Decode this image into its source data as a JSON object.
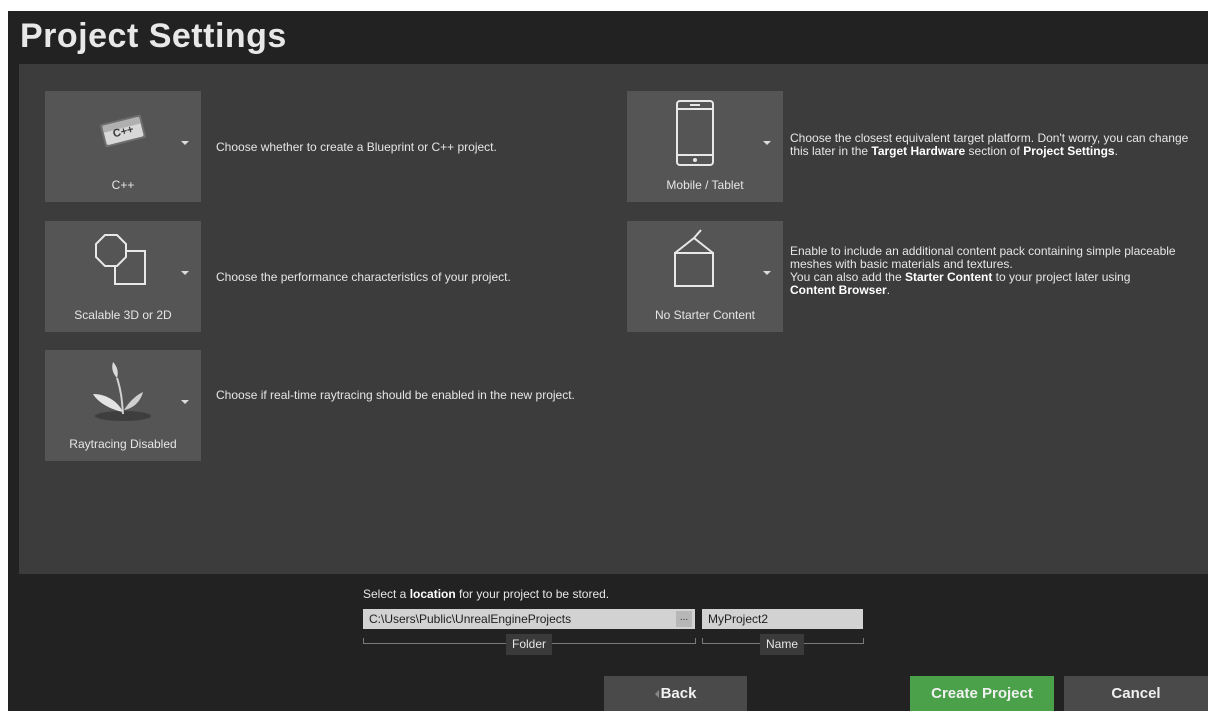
{
  "header": {
    "title": "Project Settings"
  },
  "options": [
    {
      "label": "C++",
      "description": "Choose whether to create a Blueprint or C++ project.",
      "icon": "cpp-icon"
    },
    {
      "label": "Scalable 3D or 2D",
      "description": "Choose the performance characteristics of your project.",
      "icon": "quality-shapes-icon"
    },
    {
      "label": "Raytracing Disabled",
      "description": "Choose if real-time raytracing should be enabled in the new project.",
      "icon": "plant-icon"
    },
    {
      "label": "Mobile / Tablet",
      "description_parts": [
        "Choose the closest equivalent target platform. Don't worry, you can change this later in the ",
        "Target Hardware",
        " section of ",
        "Project Settings",
        "."
      ],
      "icon": "mobile-device-icon"
    },
    {
      "label": "No Starter Content",
      "description_parts": [
        "Enable to include an additional content pack containing simple placeable meshes with basic materials and textures.",
        "You can also add the ",
        "Starter Content",
        " to your project later using ",
        "Content Browser",
        "."
      ],
      "icon": "box-icon"
    }
  ],
  "location": {
    "hint_parts": [
      "Select a ",
      "location",
      " for your project to be stored."
    ],
    "folder_value": "C:\\Users\\Public\\UnrealEngineProjects",
    "folder_label": "Folder",
    "browse_label": "...",
    "name_value": "MyProject2",
    "name_label": "Name"
  },
  "buttons": {
    "back": "Back",
    "create": "Create Project",
    "cancel": "Cancel"
  },
  "colors": {
    "accent_green": "#4aa14a",
    "panel": "#3c3c3c",
    "tile": "#555555",
    "background": "#222222"
  }
}
